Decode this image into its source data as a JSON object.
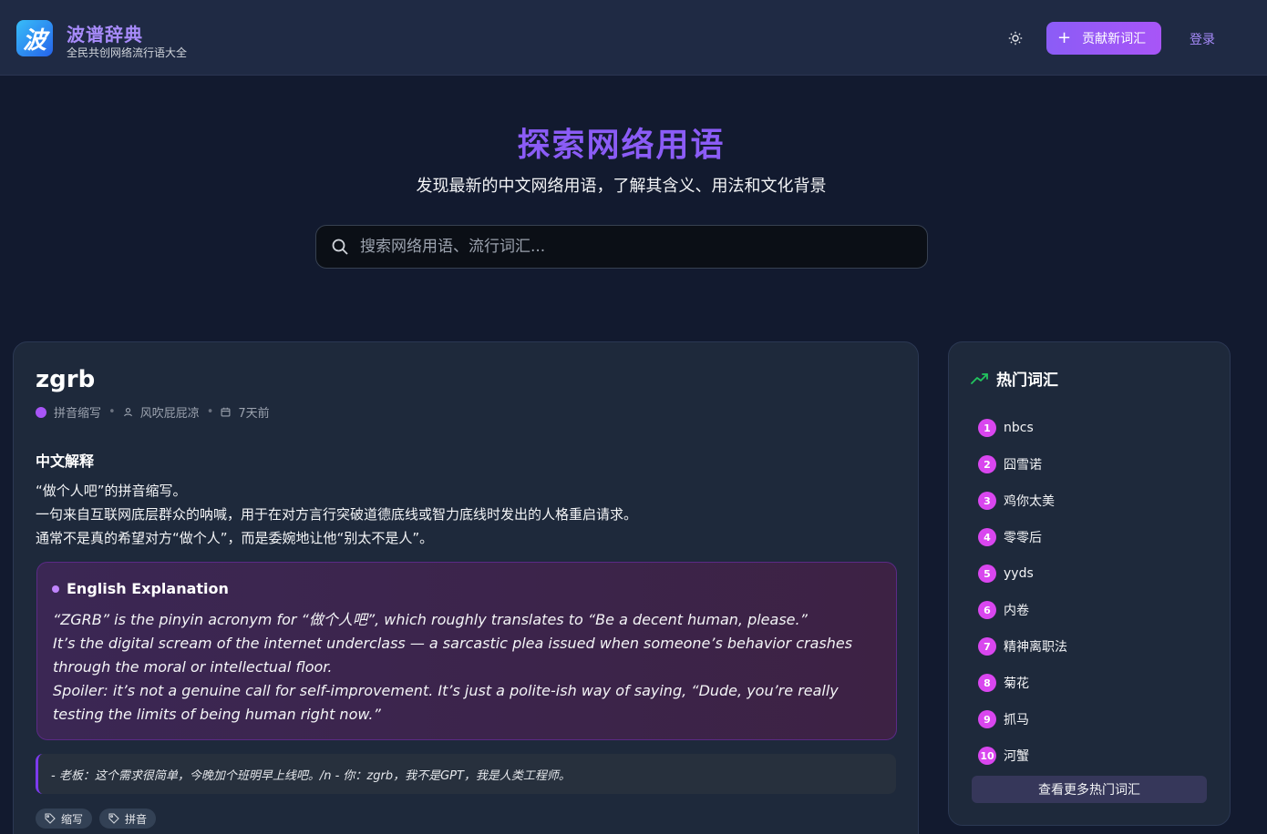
{
  "header": {
    "logo_char": "波",
    "title": "波谱辞典",
    "subtitle": "全民共创网络流行语大全",
    "contribute_label": "贡献新词汇",
    "login_label": "登录"
  },
  "hero": {
    "title": "探索网络用语",
    "subtitle": "发现最新的中文网络用语，了解其含义、用法和文化背景",
    "search_placeholder": "搜索网络用语、流行词汇..."
  },
  "entry": {
    "term": "zgrb",
    "category": "拼音缩写",
    "author": "风吹屁屁凉",
    "time": "7天前",
    "cn_heading": "中文解释",
    "cn_lines": [
      "“做个人吧”的拼音缩写。",
      "一句来自互联网底层群众的呐喊，用于在对方言行突破道德底线或智力底线时发出的人格重启请求。",
      "通常不是真的希望对方“做个人”，而是委婉地让他“别太不是人”。"
    ],
    "en_heading": "English Explanation",
    "en_lines": [
      "“ZGRB” is the pinyin acronym for “做个人吧”, which roughly translates to “Be a decent human, please.”",
      "It’s the digital scream of the internet underclass — a sarcastic plea issued when someone’s behavior crashes",
      "through the moral or intellectual floor.",
      "Spoiler: it’s not a genuine call for self-improvement. It’s just a polite-ish way of saying, “Dude, you’re really",
      "testing the limits of being human right now.”"
    ],
    "example": "- 老板：这个需求很简单，今晚加个班明早上线吧。/n - 你：zgrb，我不是GPT，我是人类工程师。",
    "tags": [
      "缩写",
      "拼音"
    ]
  },
  "sidebar": {
    "heading": "热门词汇",
    "items": [
      {
        "rank": "1",
        "label": "nbcs"
      },
      {
        "rank": "2",
        "label": "囧雪诺"
      },
      {
        "rank": "3",
        "label": "鸡你太美"
      },
      {
        "rank": "4",
        "label": "零零后"
      },
      {
        "rank": "5",
        "label": "yyds"
      },
      {
        "rank": "6",
        "label": "内卷"
      },
      {
        "rank": "7",
        "label": "精神离职法"
      },
      {
        "rank": "8",
        "label": "菊花"
      },
      {
        "rank": "9",
        "label": "抓马"
      },
      {
        "rank": "10",
        "label": "河蟹"
      }
    ],
    "more_label": "查看更多热门词汇"
  },
  "colors": {
    "accent": "#8b5cf6",
    "rank_badge": "#d946ef",
    "trend_icon": "#22c55e",
    "background": "#121a2f"
  },
  "icons": [
    "sun-icon",
    "plus-icon",
    "search-icon",
    "user-icon",
    "calendar-icon",
    "trending-up-icon",
    "tag-icon"
  ]
}
